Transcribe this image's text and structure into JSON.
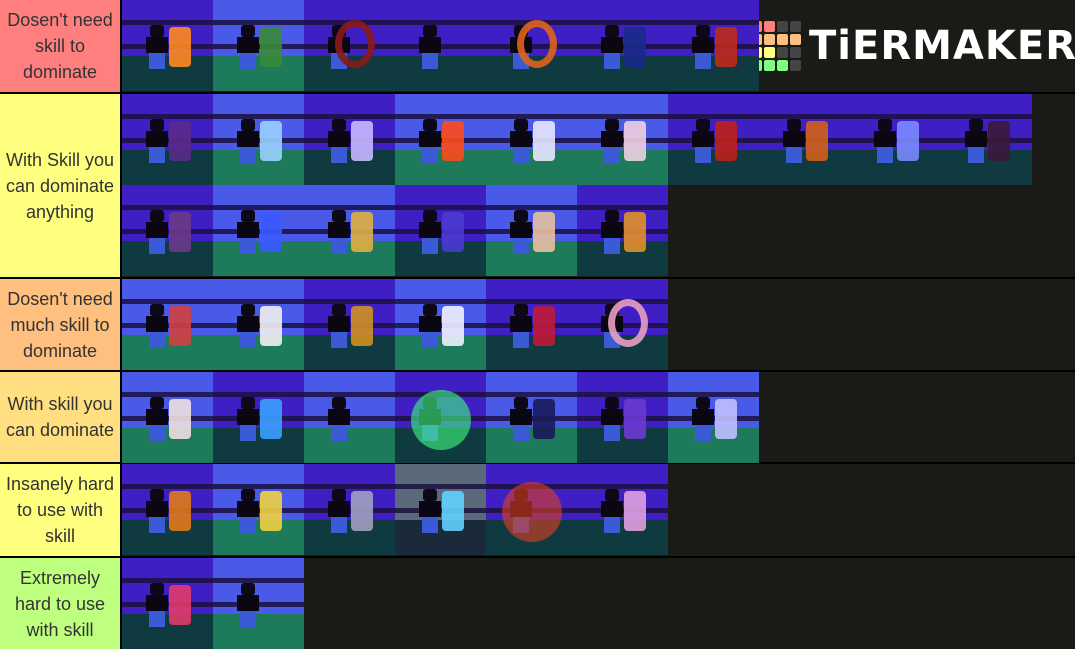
{
  "branding": {
    "logo_text": "TiERMAKER",
    "logo_grid_colors": [
      "#ff7f7f",
      "#ff7f7f",
      "#444444",
      "#444444",
      "#ffbf7f",
      "#ffbf7f",
      "#ffbf7f",
      "#ffbf7f",
      "#ffff7f",
      "#ffff7f",
      "#444444",
      "#444444",
      "#7fff7f",
      "#7fff7f",
      "#7fff7f",
      "#444444"
    ]
  },
  "colors": {
    "background": "#1a1a17",
    "separator": "#000000"
  },
  "tiers": [
    {
      "label": "Dosen't need skill to dominate",
      "color": "#ff7f7f",
      "items": [
        {
          "name": "character-with-dark-armored-stand",
          "wall": "#3f1fc4",
          "floor": "#0f3a40",
          "stand": "#ff8a1f"
        },
        {
          "name": "character-with-green-stand",
          "wall": "#4a5ae8",
          "floor": "#1d7a5a",
          "stand": "#3a8a3a"
        },
        {
          "name": "red-ring-item",
          "wall": "#3f1fc4",
          "floor": "#0f3a40",
          "stand": "#8a1a1a"
        },
        {
          "name": "character-posing",
          "wall": "#3f1fc4",
          "floor": "#0f3a40",
          "stand": ""
        },
        {
          "name": "orange-ring-item",
          "wall": "#3f1fc4",
          "floor": "#0f3a40",
          "stand": "#e0641a"
        },
        {
          "name": "character-with-blue-dark-stand",
          "wall": "#3f1fc4",
          "floor": "#0f3a40",
          "stand": "#1a2a8a"
        },
        {
          "name": "character-with-red-outlined-stand",
          "wall": "#3f1fc4",
          "floor": "#0f3a40",
          "stand": "#c02a1a"
        }
      ]
    },
    {
      "label": "With Skill you can dominate anything",
      "color": "#ffff7f",
      "items": [
        {
          "name": "character-with-dark-purple-stand",
          "wall": "#3f1fc4",
          "floor": "#0f3a40",
          "stand": "#5a2a8a"
        },
        {
          "name": "character-with-white-blue-stand",
          "wall": "#4a5ae8",
          "floor": "#1d7a5a",
          "stand": "#9ad0ff"
        },
        {
          "name": "character-with-white-purple-stand",
          "wall": "#3f1fc4",
          "floor": "#0f3a40",
          "stand": "#c8b8ff"
        },
        {
          "name": "character-with-fire-effect",
          "wall": "#4a5ae8",
          "floor": "#1d7a5a",
          "stand": "#ff4a1a"
        },
        {
          "name": "character-with-white-green-stand",
          "wall": "#4a5ae8",
          "floor": "#1d7a5a",
          "stand": "#e8e8ff"
        },
        {
          "name": "character-with-white-red-stand",
          "wall": "#4a5ae8",
          "floor": "#1d7a5a",
          "stand": "#f0d0e0"
        },
        {
          "name": "character-with-red-diamond-stand",
          "wall": "#3f1fc4",
          "floor": "#0f3a40",
          "stand": "#c0201a"
        },
        {
          "name": "character-with-orange-stand",
          "wall": "#3f1fc4",
          "floor": "#0f3a40",
          "stand": "#d0601a"
        },
        {
          "name": "character-with-light-blue-stand",
          "wall": "#3f1fc4",
          "floor": "#0f3a40",
          "stand": "#7a8aff"
        },
        {
          "name": "character-with-pink-glow-stand",
          "wall": "#3f1fc4",
          "floor": "#0f3a40",
          "stand": "#3a1a3a"
        },
        {
          "name": "character-with-dark-orange-stand",
          "wall": "#3f1fc4",
          "floor": "#0f3a40",
          "stand": "#6a3a8a"
        },
        {
          "name": "character-with-blue-gold-stand",
          "wall": "#4a5ae8",
          "floor": "#1d7a5a",
          "stand": "#3a5aff"
        },
        {
          "name": "character-with-gold-stand",
          "wall": "#4a5ae8",
          "floor": "#1d7a5a",
          "stand": "#e0b040"
        },
        {
          "name": "character-with-violet-stand",
          "wall": "#3f1fc4",
          "floor": "#0f3a40",
          "stand": "#4a3ad0"
        },
        {
          "name": "character-with-beige-stand",
          "wall": "#4a5ae8",
          "floor": "#1d7a5a",
          "stand": "#e8c0a0"
        },
        {
          "name": "character-with-tan-stand",
          "wall": "#3f1fc4",
          "floor": "#0f3a40",
          "stand": "#e0902a"
        }
      ]
    },
    {
      "label": "Dosen't need much skill to dominate",
      "color": "#ffbf7f",
      "items": [
        {
          "name": "character-with-flag",
          "wall": "#4a5ae8",
          "floor": "#1d7a5a",
          "stand": "#d04040"
        },
        {
          "name": "character-with-white-red-box-stand",
          "wall": "#4a5ae8",
          "floor": "#1d7a5a",
          "stand": "#f0f0f0"
        },
        {
          "name": "character-with-gold-purple-stand",
          "wall": "#3f1fc4",
          "floor": "#0f3a40",
          "stand": "#d09020"
        },
        {
          "name": "character-with-black-white-stand",
          "wall": "#4a5ae8",
          "floor": "#1d7a5a",
          "stand": "#f0f0ff"
        },
        {
          "name": "character-with-red-glow",
          "wall": "#3f1fc4",
          "floor": "#0f3a40",
          "stand": "#c01a3a"
        },
        {
          "name": "character-with-ring",
          "wall": "#3f1fc4",
          "floor": "#0f3a40",
          "stand": "#e8a0c0"
        }
      ]
    },
    {
      "label": "With skill you can dominate",
      "color": "#ffdf7f",
      "items": [
        {
          "name": "character-with-box",
          "wall": "#4a5ae8",
          "floor": "#1d7a5a",
          "stand": "#f0e0e0"
        },
        {
          "name": "character-with-sword",
          "wall": "#3f1fc4",
          "floor": "#0f3a40",
          "stand": "#3aa0ff"
        },
        {
          "name": "character-standing",
          "wall": "#4a5ae8",
          "floor": "#1d7a5a",
          "stand": ""
        },
        {
          "name": "character-with-green-aura",
          "wall": "#3f1fc4",
          "floor": "#0f3a40",
          "stand": "#40ff80"
        },
        {
          "name": "character-with-dark-blue-stand",
          "wall": "#4a5ae8",
          "floor": "#1d7a5a",
          "stand": "#1a1a5a"
        },
        {
          "name": "character-with-purple-stand",
          "wall": "#3f1fc4",
          "floor": "#0f3a40",
          "stand": "#6a3ad0"
        },
        {
          "name": "character-with-katana",
          "wall": "#4a5ae8",
          "floor": "#1d7a5a",
          "stand": "#c0c0ff"
        }
      ]
    },
    {
      "label": "Insanely hard to use with skill",
      "color": "#ffff7f",
      "items": [
        {
          "name": "character-with-orange-block-stand",
          "wall": "#3f1fc4",
          "floor": "#0f3a40",
          "stand": "#e07a1a"
        },
        {
          "name": "character-with-yellow-stand",
          "wall": "#4a5ae8",
          "floor": "#1d7a5a",
          "stand": "#f0d040"
        },
        {
          "name": "character-with-grey-stand",
          "wall": "#3f1fc4",
          "floor": "#0f3a40",
          "stand": "#a0a0c0"
        },
        {
          "name": "character-with-neon-suit",
          "wall": "#5a6a7a",
          "floor": "#1a2a3a",
          "stand": "#60d0ff"
        },
        {
          "name": "character-with-burst-effect",
          "wall": "#3f1fc4",
          "floor": "#0f3a40",
          "stand": "#e04020"
        },
        {
          "name": "character-with-pink-stand",
          "wall": "#3f1fc4",
          "floor": "#0f3a40",
          "stand": "#e0a0e0"
        }
      ]
    },
    {
      "label": "Extremely hard to use with skill",
      "color": "#bfff7f",
      "items": [
        {
          "name": "character-with-red-blue-stand",
          "wall": "#3f1fc4",
          "floor": "#0f3a40",
          "stand": "#e03a6a"
        },
        {
          "name": "character-closeup",
          "wall": "#4a5ae8",
          "floor": "#1d7a5a",
          "stand": ""
        }
      ]
    }
  ]
}
